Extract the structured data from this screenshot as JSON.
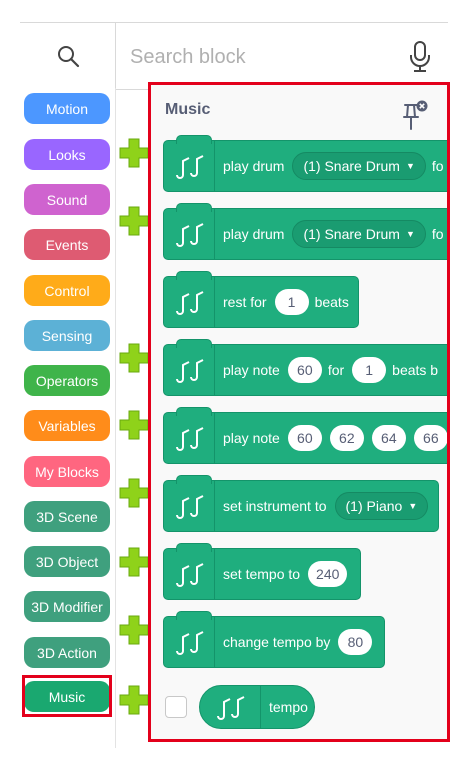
{
  "search": {
    "placeholder": "Search block"
  },
  "categories": [
    {
      "label": "Motion",
      "color": "#4c97ff"
    },
    {
      "label": "Looks",
      "color": "#9966ff"
    },
    {
      "label": "Sound",
      "color": "#cf63cf"
    },
    {
      "label": "Events",
      "color": "#de5b72"
    },
    {
      "label": "Control",
      "color": "#ffab19"
    },
    {
      "label": "Sensing",
      "color": "#5cb1d6"
    },
    {
      "label": "Operators",
      "color": "#3fb44a"
    },
    {
      "label": "Variables",
      "color": "#ff8c1a"
    },
    {
      "label": "My Blocks",
      "color": "#ff6680"
    },
    {
      "label": "3D Scene",
      "color": "#3fa07e"
    },
    {
      "label": "3D Object",
      "color": "#3fa07e"
    },
    {
      "label": "3D Modifier",
      "color": "#3fa07e"
    },
    {
      "label": "3D Action",
      "color": "#3fa07e"
    },
    {
      "label": "Music",
      "color": "#1aa870",
      "selected": true
    }
  ],
  "flyout": {
    "title": "Music",
    "blocks": [
      {
        "parts": [
          "play drum",
          "(1) Snare Drum",
          "fo"
        ]
      },
      {
        "parts": [
          "play drum",
          "(1) Snare Drum",
          "fo"
        ]
      },
      {
        "parts": [
          "rest for",
          "1",
          "beats"
        ]
      },
      {
        "parts": [
          "play note",
          "60",
          "for",
          "1",
          "beats b"
        ]
      },
      {
        "parts": [
          "play note",
          "60",
          "62",
          "64",
          "66"
        ]
      },
      {
        "parts": [
          "set instrument to",
          "(1) Piano"
        ]
      },
      {
        "parts": [
          "set tempo to",
          "240"
        ]
      },
      {
        "parts": [
          "change tempo by",
          "80"
        ]
      }
    ],
    "reporter": {
      "label": "tempo"
    }
  },
  "colors": {
    "music_block": "#1fae7e",
    "highlight": "#e3001b",
    "plus": "#8fd21a"
  }
}
